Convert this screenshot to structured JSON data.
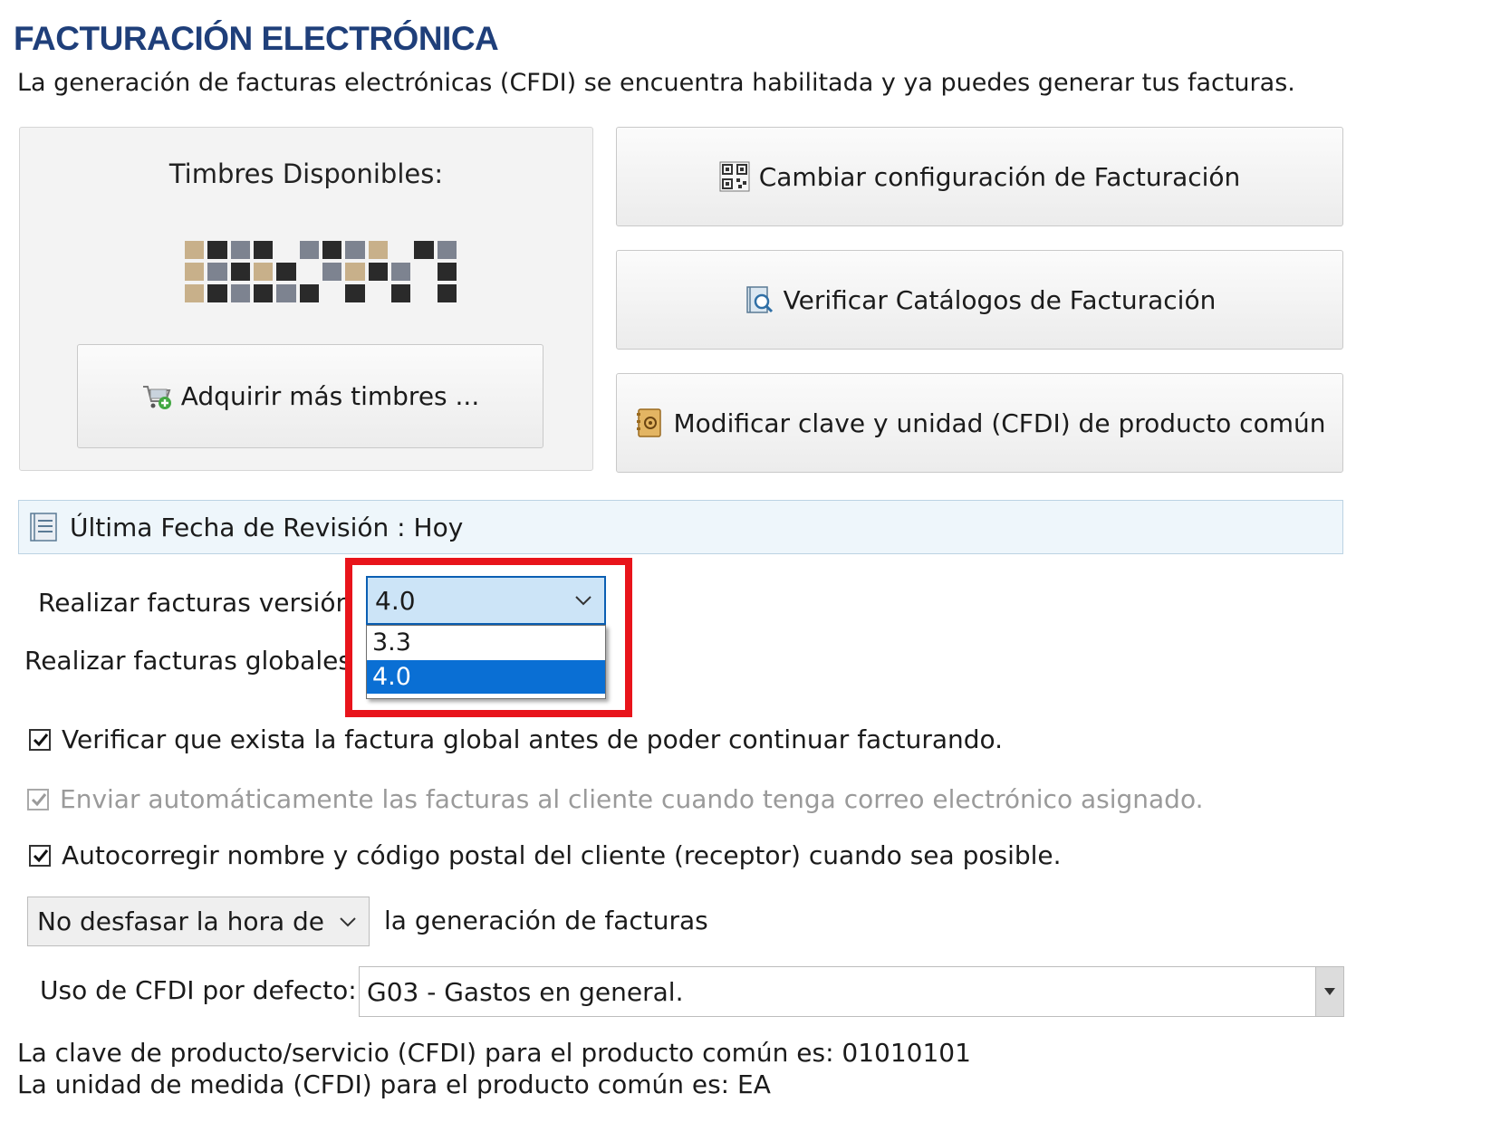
{
  "header": {
    "title": "FACTURACIÓN ELECTRÓNICA",
    "subtitle": "La generación de facturas electrónicas (CFDI) se encuentra habilitada y ya puedes generar tus facturas."
  },
  "stamps": {
    "label": "Timbres Disponibles:",
    "buy_button": "Adquirir más timbres ..."
  },
  "actions": {
    "config_button": "Cambiar configuración de Facturación",
    "catalogs_button": "Verificar Catálogos de Facturación",
    "modify_button": "Modificar clave y unidad (CFDI) de producto común"
  },
  "revision": {
    "text": "Última Fecha de Revisión : Hoy"
  },
  "version": {
    "label": "Realizar facturas versión",
    "selected": "4.0",
    "options": [
      "3.3",
      "4.0"
    ]
  },
  "global": {
    "label": "Realizar facturas globales"
  },
  "checkboxes": [
    {
      "label": "Verificar que exista la factura global antes de poder continuar facturando.",
      "checked": true,
      "enabled": true
    },
    {
      "label": "Enviar automáticamente las facturas al cliente cuando tenga correo electrónico asignado.",
      "checked": true,
      "enabled": false
    },
    {
      "label": "Autocorregir nombre y código postal del cliente (receptor) cuando sea posible.",
      "checked": true,
      "enabled": true
    }
  ],
  "time_shift": {
    "selected": "No desfasar la hora de",
    "suffix": "la generación de facturas"
  },
  "cfdi_use": {
    "label": "Uso de CFDI por defecto:",
    "selected": "G03 - Gastos en general."
  },
  "footer": {
    "product_key": "La clave de producto/servicio (CFDI) para el producto común es: 01010101",
    "unit": "La unidad de medida (CFDI) para el producto común es: EA"
  },
  "colors": {
    "title": "#1f3f7a",
    "highlight": "#e8141b",
    "selection": "#0a6fd4",
    "combo_bg": "#cce4f7"
  }
}
